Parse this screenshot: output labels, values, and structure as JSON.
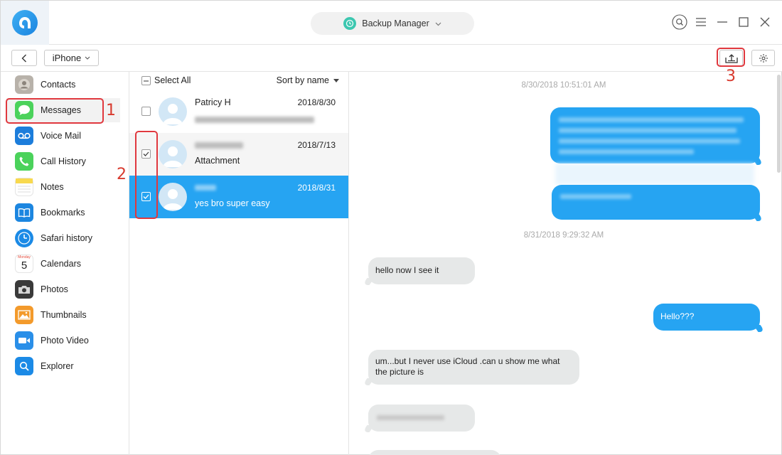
{
  "header": {
    "title": "Backup Manager",
    "accent_color": "#26a4f2"
  },
  "toolbar": {
    "device": "iPhone"
  },
  "annotations": {
    "one": "1",
    "two": "2",
    "three": "3",
    "color": "#e0383e"
  },
  "sidebar": {
    "items": [
      {
        "label": "Contacts",
        "icon": "contacts-icon"
      },
      {
        "label": "Messages",
        "icon": "messages-icon"
      },
      {
        "label": "Voice Mail",
        "icon": "voicemail-icon"
      },
      {
        "label": "Call History",
        "icon": "phone-icon"
      },
      {
        "label": "Notes",
        "icon": "notes-icon"
      },
      {
        "label": "Bookmarks",
        "icon": "bookmarks-icon"
      },
      {
        "label": "Safari history",
        "icon": "safari-icon"
      },
      {
        "label": "Calendars",
        "icon": "calendar-icon"
      },
      {
        "label": "Photos",
        "icon": "camera-icon"
      },
      {
        "label": "Thumbnails",
        "icon": "thumbnails-icon"
      },
      {
        "label": "Photo Video",
        "icon": "video-icon"
      },
      {
        "label": "Explorer",
        "icon": "explorer-icon"
      }
    ],
    "calendar_day": "5",
    "calendar_month": "Monday"
  },
  "list": {
    "select_all": "Select All",
    "sort_label": "Sort by name",
    "rows": [
      {
        "name": "Patricy H",
        "date": "2018/8/30",
        "snippet": ""
      },
      {
        "name": "",
        "date": "2018/7/13",
        "snippet": "Attachment"
      },
      {
        "name": "",
        "date": "2018/8/31",
        "snippet": "yes bro super easy"
      }
    ]
  },
  "chat": {
    "stamp1": "8/30/2018 10:51:01 AM",
    "stamp2": "8/31/2018 9:29:32 AM",
    "msg1": "hello now I see it",
    "msg2": "Hello???",
    "msg3": "um...but I never use iCloud .can u show me what the picture is"
  }
}
